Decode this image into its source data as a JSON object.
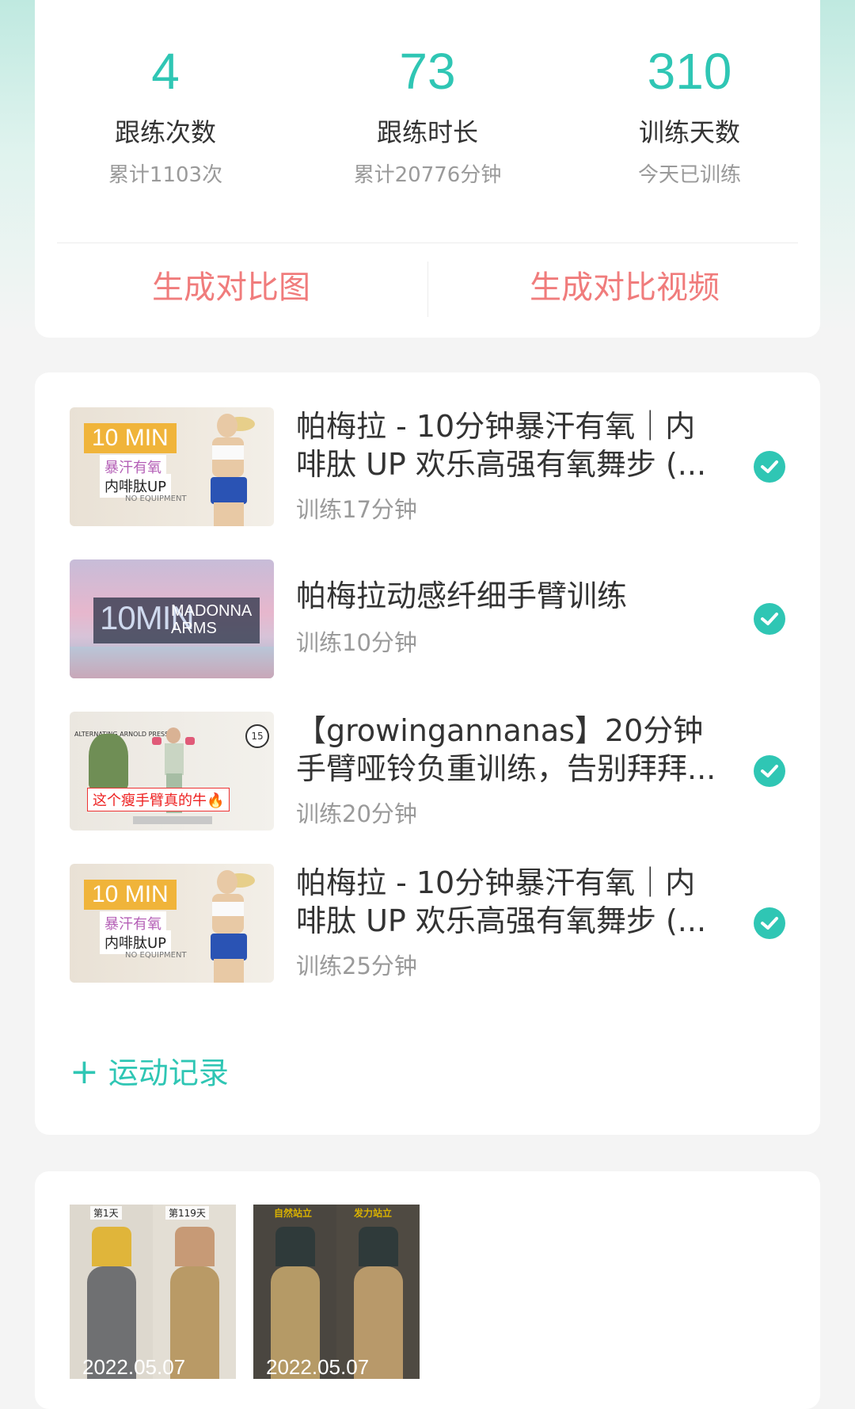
{
  "stats": [
    {
      "number": "4",
      "label": "跟练次数",
      "sub": "累计1103次"
    },
    {
      "number": "73",
      "label": "跟练时长",
      "sub": "累计20776分钟"
    },
    {
      "number": "310",
      "label": "训练天数",
      "sub": "今天已训练"
    }
  ],
  "actions": {
    "compare_image": "生成对比图",
    "compare_video": "生成对比视频"
  },
  "workouts": [
    {
      "title": "帕梅拉 - 10分钟暴汗有氧｜内啡肽 UP 欢乐高强有氧舞步 (...",
      "meta": "训练17分钟",
      "thumb_tag": "10 MIN",
      "thumb_sub1": "暴汗有氧",
      "thumb_sub2": "内啡肽UP",
      "thumb_note": "NO EQUIPMENT"
    },
    {
      "title": "帕梅拉动感纤细手臂训练",
      "meta": "训练10分钟",
      "thumb_big": "10MIN",
      "thumb_small": "MADONNA ARMS"
    },
    {
      "title": "【growingannanas】20分钟手臂哑铃负重训练，告别拜拜...",
      "meta": "训练20分钟",
      "thumb_caption": "这个瘦手臂真的牛🔥",
      "thumb_badge": "15",
      "thumb_top": "ALTERNATING ARNOLD PRESS"
    },
    {
      "title": "帕梅拉 - 10分钟暴汗有氧｜内啡肽 UP 欢乐高强有氧舞步 (...",
      "meta": "训练25分钟",
      "thumb_tag": "10 MIN",
      "thumb_sub1": "暴汗有氧",
      "thumb_sub2": "内啡肽UP",
      "thumb_note": "NO EQUIPMENT"
    }
  ],
  "add_record": {
    "icon": "plus-icon",
    "label": "运动记录"
  },
  "photos": [
    {
      "date": "2022.05.07",
      "left_label": "第1天",
      "right_label": "第119天"
    },
    {
      "date": "2022.05.07",
      "left_label": "自然站立",
      "right_label": "发力站立"
    }
  ],
  "colors": {
    "accent": "#2fc6b4",
    "action": "#f07c7c"
  }
}
